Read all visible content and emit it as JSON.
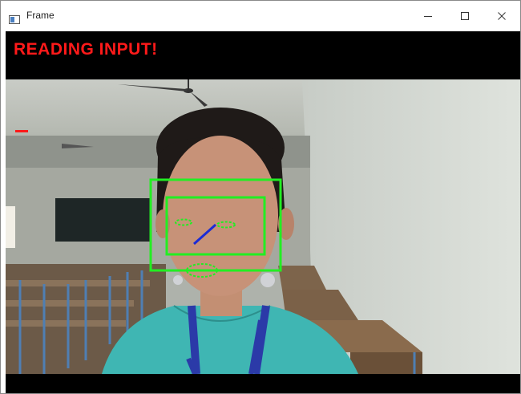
{
  "window": {
    "title": "Frame",
    "icon": "window-app-icon",
    "controls": [
      "minimize-icon",
      "maximize-icon",
      "close-icon"
    ]
  },
  "overlay": {
    "status_text": "READING INPUT!",
    "status_color": "#ff1a1a",
    "detection_color": "#22ee22",
    "gaze_line_color": "#1a2bd6"
  }
}
